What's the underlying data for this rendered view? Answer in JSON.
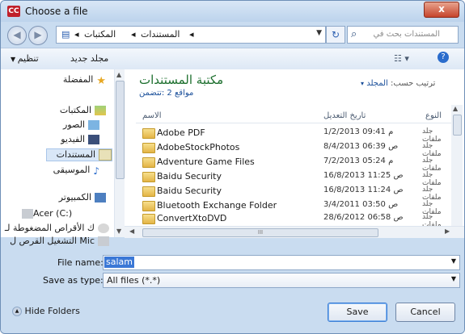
{
  "window": {
    "title": "Choose a file",
    "close": "x",
    "app_icon_text": "CC"
  },
  "nav": {
    "back": "◀",
    "forward": "▶",
    "address": [
      "المكتبات",
      "المستندات"
    ],
    "search_placeholder": "المستندات بحث في"
  },
  "toolbar": {
    "organize": "تنظيم",
    "new_folder": "مجلد جديد"
  },
  "sidebar": {
    "favorites": "المفضلة",
    "libraries": "المكتبات",
    "items": [
      "الصور",
      "الفيديو",
      "المستندات",
      "الموسيقى"
    ],
    "computer": "الكمبيوتر",
    "drives": [
      "Acer (C:)",
      "ك الأقراص المضغوطة لـ",
      "Mic التشغيل القرص ل"
    ]
  },
  "library": {
    "title": "مكتبة المستندات",
    "subtitle": "مواقع 2 :تتضمن",
    "arrange_label": "ترتيب حسب:",
    "arrange_value": "المجلد"
  },
  "columns": {
    "name": "الاسم",
    "date": "تاريخ التعديل",
    "type": "النوع"
  },
  "files": [
    {
      "name": "Adobe PDF",
      "date": "1/2/2013 09:41 م",
      "type": "جلد ملفات"
    },
    {
      "name": "AdobeStockPhotos",
      "date": "8/4/2013 06:39 ص",
      "type": "جلد ملفات"
    },
    {
      "name": "Adventure Game Files",
      "date": "7/2/2013 05:24 م",
      "type": "جلد ملفات"
    },
    {
      "name": "Baidu Security",
      "date": "16/8/2013 11:25 ص",
      "type": "جلد ملفات"
    },
    {
      "name": "Baidu Security",
      "date": "16/8/2013 11:24 ص",
      "type": "جلد ملفات"
    },
    {
      "name": "Bluetooth Exchange Folder",
      "date": "3/4/2011 03:50 ص",
      "type": "جلد ملفات"
    },
    {
      "name": "ConvertXtoDVD",
      "date": "28/6/2012 06:58 ص",
      "type": "جلد ملفات"
    }
  ],
  "form": {
    "file_name_label": "File name:",
    "file_name_value": "salam",
    "save_type_label": "Save as type:",
    "save_type_value": "All files (*.*)"
  },
  "buttons": {
    "hide_folders": "Hide Folders",
    "save": "Save",
    "cancel": "Cancel"
  }
}
